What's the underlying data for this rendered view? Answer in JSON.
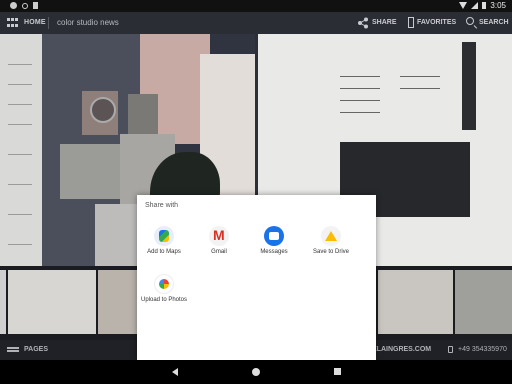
{
  "status_bar": {
    "time": "3:05"
  },
  "app_bar": {
    "home_label": "HOME",
    "title": "color studio news",
    "share_label": "SHARE",
    "favorites_label": "FAVORITES",
    "search_label": "SEARCH"
  },
  "bottom_bar": {
    "pages_label": "PAGES",
    "website": "ELAINGRES.COM",
    "phone": "+49 354335970"
  },
  "share_sheet": {
    "title": "Share with",
    "targets": [
      {
        "label": "Add to Maps",
        "icon": "maps-icon"
      },
      {
        "label": "Gmail",
        "icon": "gmail-icon"
      },
      {
        "label": "Messages",
        "icon": "messages-icon"
      },
      {
        "label": "Save to Drive",
        "icon": "drive-icon"
      },
      {
        "label": "Upload to Photos",
        "icon": "photos-icon"
      }
    ]
  },
  "nav_bar": {
    "icons": [
      "back-icon",
      "home-icon",
      "recents-icon"
    ]
  }
}
